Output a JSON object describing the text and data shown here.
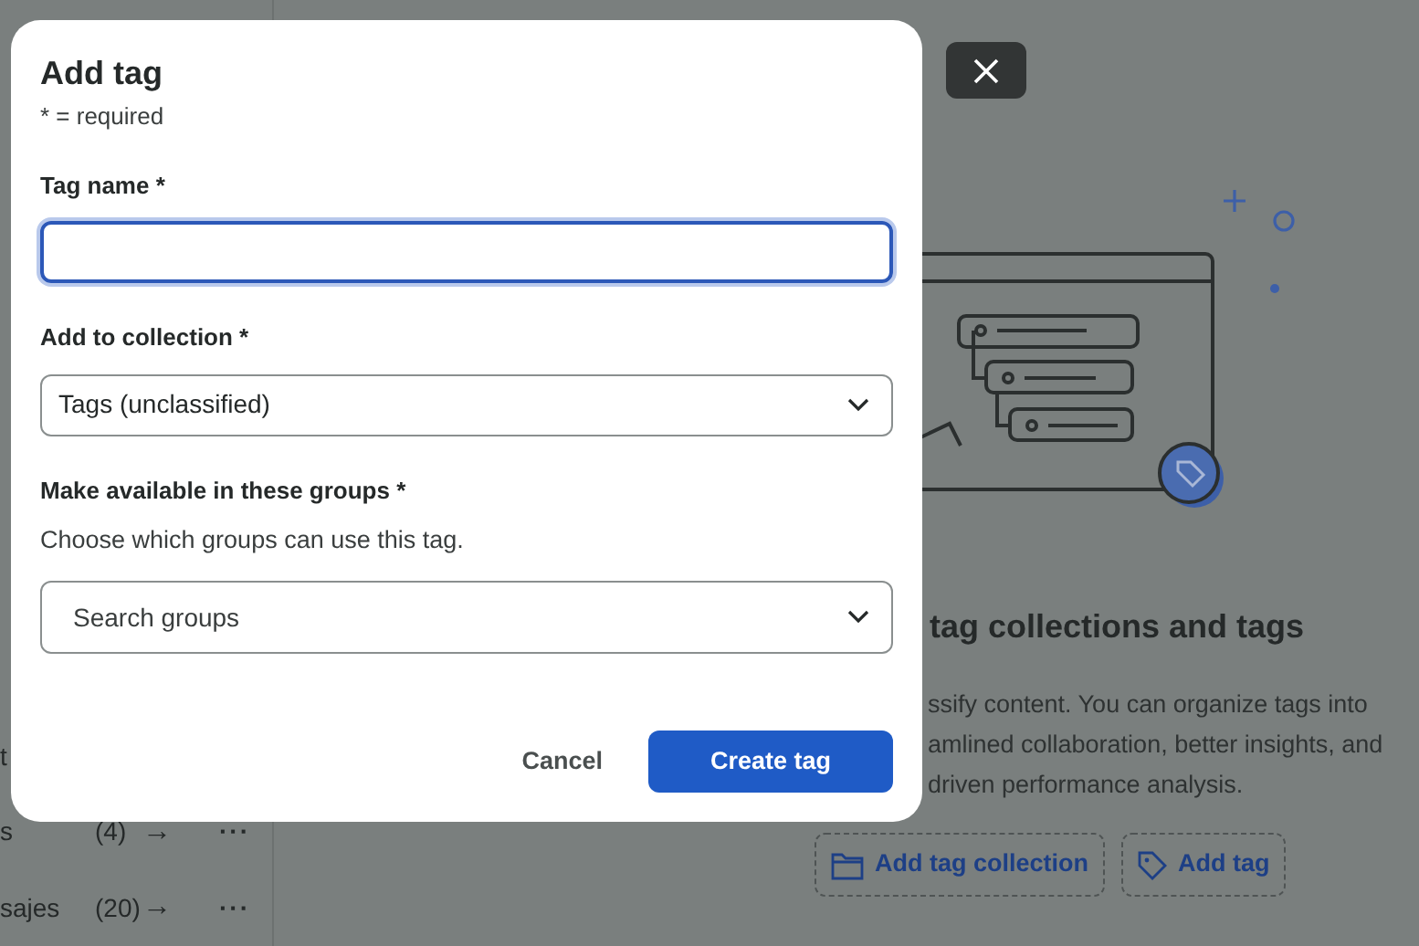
{
  "sidebar": {
    "rows": [
      {
        "name": "t"
      },
      {
        "name": "s",
        "count": "(4)",
        "arrow": "→",
        "more": "···"
      },
      {
        "name": "sajes",
        "count": "(20)",
        "arrow": "→",
        "more": "···"
      }
    ]
  },
  "empty_state": {
    "heading": "tag collections and tags",
    "lines": [
      "ssify content. You can organize tags into",
      "amlined collaboration, better insights, and",
      "driven performance analysis."
    ],
    "buttons": [
      {
        "label": "Add tag collection",
        "kind": "collection"
      },
      {
        "label": "Add tag",
        "kind": "tag"
      }
    ]
  },
  "dialog": {
    "title": "Add tag",
    "note": "* = required",
    "fields": [
      {
        "kind": "text",
        "label": "Tag name *",
        "focused": true
      },
      {
        "kind": "select",
        "label": "Add to collection *",
        "value": "Tags (unclassified)"
      },
      {
        "kind": "search",
        "label": "Make available in these groups *",
        "help": "Choose which groups can use this tag.",
        "placeholder": "Search groups"
      }
    ],
    "buttons": [
      {
        "label": "Cancel",
        "kind": "secondary"
      },
      {
        "label": "Create tag",
        "kind": "primary"
      }
    ]
  }
}
